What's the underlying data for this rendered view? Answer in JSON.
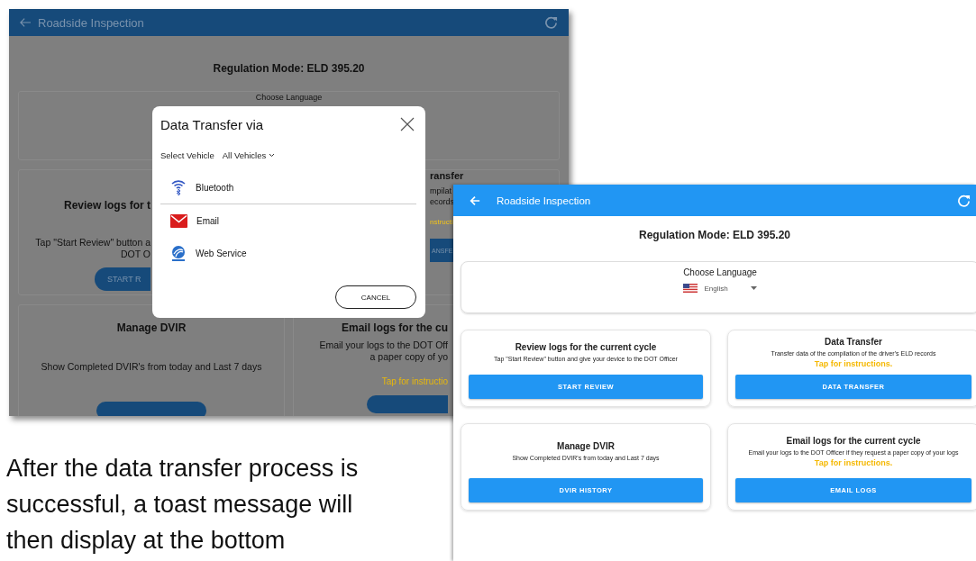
{
  "background_screen": {
    "title": "Roadside Inspection",
    "regulation": "Regulation Mode: ELD 395.20",
    "language_label": "Choose Language",
    "cards": [
      {
        "title": "Review logs for t",
        "lines": [
          "Tap \"Start Review\" button a",
          "DOT O"
        ],
        "button": {
          "label": "START R"
        }
      },
      {
        "title": "ransfer",
        "lines": [
          "mpilat",
          "ecords"
        ],
        "link": "nstructi",
        "button": {
          "label": "ANSFE"
        }
      },
      {
        "title": "Manage DVIR",
        "lines": [
          "Show Completed DVIR's from today and Last 7 days"
        ],
        "button": {
          "cut_off": true
        }
      },
      {
        "title": "Email logs for the cu",
        "lines": [
          "Email your logs to the DOT Off",
          "a paper copy of yo"
        ],
        "link": "Tap for instructio",
        "button": {
          "cut_off": true
        }
      }
    ]
  },
  "dialog": {
    "title": "Data Transfer via",
    "vehicle_label": "Select Vehicle",
    "vehicle_value": "All Vehicles",
    "options": [
      {
        "kind": "bluetooth",
        "label": "Bluetooth"
      },
      {
        "kind": "email",
        "label": "Email"
      },
      {
        "kind": "web",
        "label": "Web Service"
      }
    ],
    "cancel": "CANCEL"
  },
  "foreground_screen": {
    "title": "Roadside Inspection",
    "regulation": "Regulation Mode: ELD 395.20",
    "language_label": "Choose Language",
    "language": "English",
    "cards": [
      {
        "title": "Review logs for the current cycle",
        "lines": [
          "Tap \"Start Review\" button and give your device to the DOT Officer"
        ],
        "button": {
          "label": "START REVIEW"
        }
      },
      {
        "title": "Data Transfer",
        "lines": [
          "Transfer data of the compilation of the driver's ELD records"
        ],
        "link": "Tap for instructions.",
        "button": {
          "label": "DATA TRANSFER"
        }
      },
      {
        "title": "Manage DVIR",
        "lines": [
          "Show Completed DVIR's from today and Last 7 days"
        ],
        "button": {
          "label": "DVIR HISTORY"
        }
      },
      {
        "title": "Email logs for the current cycle",
        "lines": [
          "Email your logs to the DOT Officer if they request a paper copy of your logs"
        ],
        "link": "Tap for instructions.",
        "button": {
          "label": "EMAIL LOGS"
        }
      }
    ]
  },
  "document": {
    "paragraph": "After the data transfer process is successful, a toast message will then display at the bottom"
  }
}
